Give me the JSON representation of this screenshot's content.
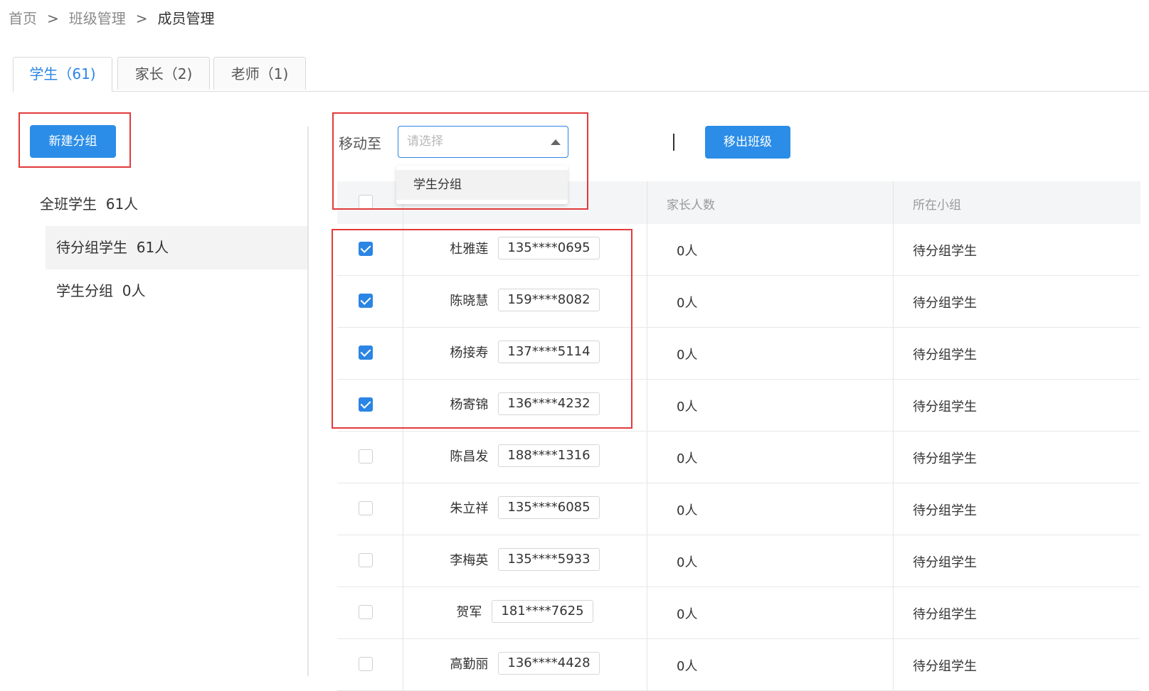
{
  "breadcrumb": {
    "home": "首页",
    "level2": "班级管理",
    "current": "成员管理",
    "separator": ">"
  },
  "tabs": [
    {
      "label": "学生（61)",
      "active": true
    },
    {
      "label": "家长（2)",
      "active": false
    },
    {
      "label": "老师（1)",
      "active": false
    }
  ],
  "left": {
    "new_group_button": "新建分组",
    "groups": [
      {
        "label": "全班学生",
        "count": "61人"
      },
      {
        "label": "待分组学生",
        "count": "61人"
      },
      {
        "label": "学生分组",
        "count": "0人"
      }
    ]
  },
  "toolbar": {
    "move_label": "移动至",
    "select_placeholder": "请选择",
    "dropdown_option": "学生分组",
    "pipe": "|",
    "remove_button": "移出班级"
  },
  "table": {
    "headers": {
      "parents": "家长人数",
      "group": "所在小组"
    },
    "rows": [
      {
        "name": "杜雅莲",
        "phone": "135****0695",
        "parents": "0人",
        "group": "待分组学生",
        "checked": true
      },
      {
        "name": "陈晓慧",
        "phone": "159****8082",
        "parents": "0人",
        "group": "待分组学生",
        "checked": true
      },
      {
        "name": "杨接寿",
        "phone": "137****5114",
        "parents": "0人",
        "group": "待分组学生",
        "checked": true
      },
      {
        "name": "杨寄锦",
        "phone": "136****4232",
        "parents": "0人",
        "group": "待分组学生",
        "checked": true
      },
      {
        "name": "陈昌发",
        "phone": "188****1316",
        "parents": "0人",
        "group": "待分组学生",
        "checked": false
      },
      {
        "name": "朱立祥",
        "phone": "135****6085",
        "parents": "0人",
        "group": "待分组学生",
        "checked": false
      },
      {
        "name": "李梅英",
        "phone": "135****5933",
        "parents": "0人",
        "group": "待分组学生",
        "checked": false
      },
      {
        "name": "贺军",
        "phone": "181****7625",
        "parents": "0人",
        "group": "待分组学生",
        "checked": false
      },
      {
        "name": "高勤丽",
        "phone": "136****4428",
        "parents": "0人",
        "group": "待分组学生",
        "checked": false
      }
    ]
  },
  "colors": {
    "primary": "#2b85e4",
    "highlight": "#e23a3a"
  }
}
